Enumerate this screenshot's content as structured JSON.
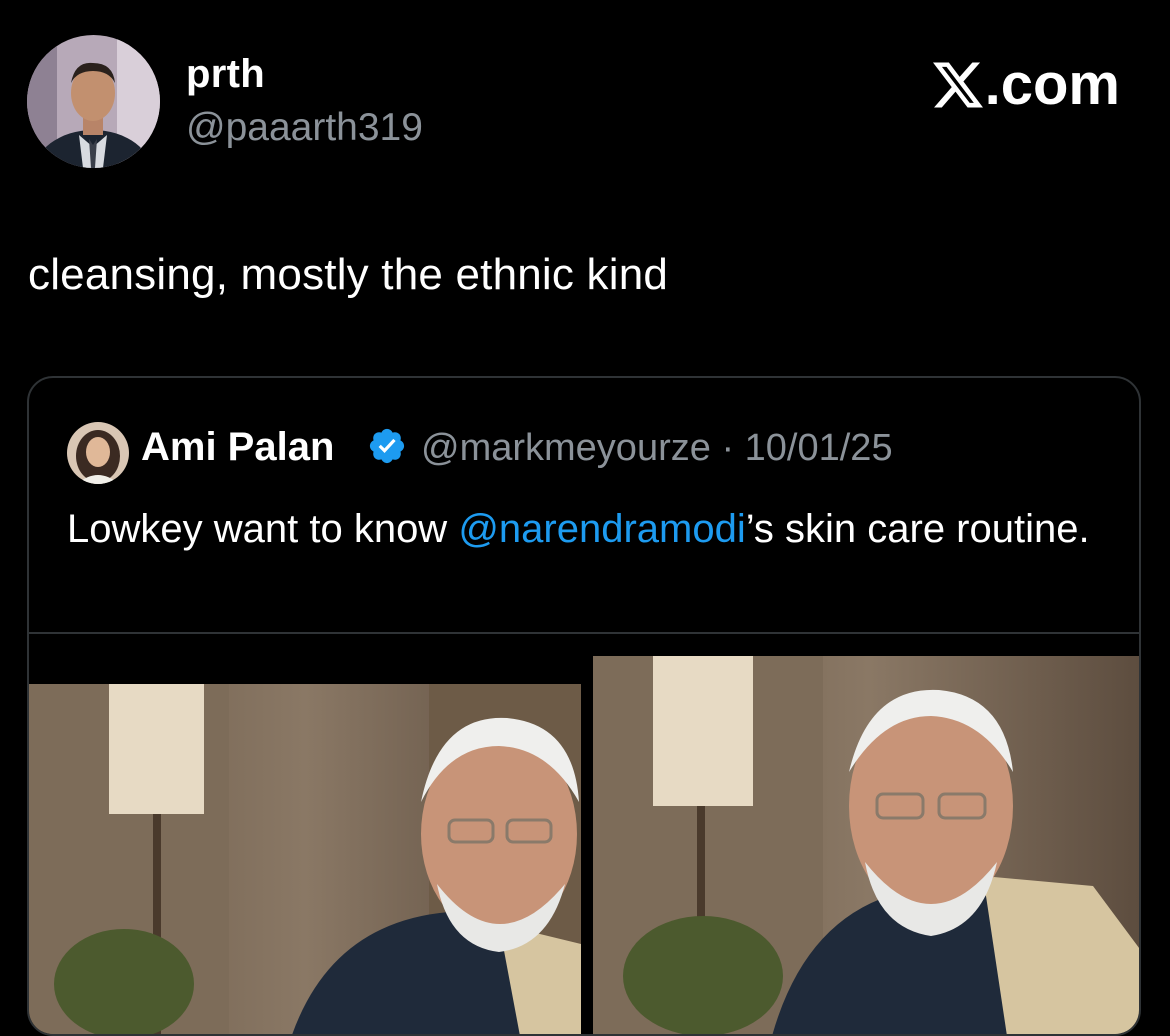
{
  "header": {
    "display_name": "prth",
    "handle": "@paaarth319",
    "brand_label": ".com",
    "brand_icon": "x-logo-icon"
  },
  "tweet": {
    "text": "cleansing, mostly the ethnic kind"
  },
  "quote": {
    "author_name": "Ami Palan",
    "verified_icon": "verified-badge-icon",
    "handle": "@markmeyourze",
    "separator": "·",
    "date": "10/01/25",
    "text_before": "Lowkey want to know ",
    "mention": "@narendramodi",
    "text_after": "’s skin care routine."
  },
  "colors": {
    "background": "#000000",
    "text": "#ffffff",
    "muted": "#8b9299",
    "link": "#1d9bf0",
    "border": "#2f3336"
  }
}
